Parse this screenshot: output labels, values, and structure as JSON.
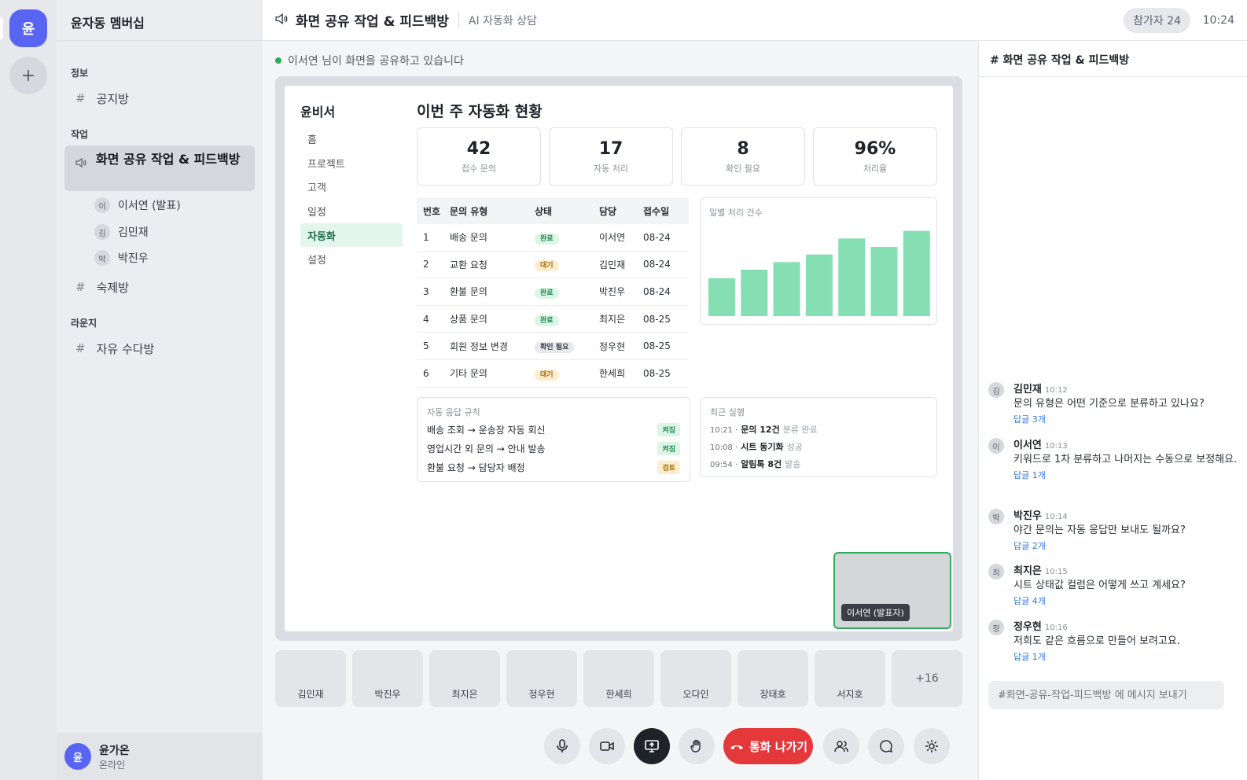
{
  "rail": {
    "server_initial": "윤",
    "add_label": "+"
  },
  "sidebar": {
    "server_name": "윤자동 멤버십",
    "categories": [
      {
        "name": "정보"
      },
      {
        "name": "작업"
      },
      {
        "name": "라운지"
      }
    ],
    "channels": {
      "notice": "공지방",
      "active": "화면 공유 작업 & 피드백방",
      "homework": "숙제방",
      "free": "자유 수다방"
    },
    "voice_users": [
      {
        "initial": "이",
        "name": "이서연 (발표)"
      },
      {
        "initial": "김",
        "name": "김민재"
      },
      {
        "initial": "박",
        "name": "박진우"
      }
    ],
    "me": {
      "initial": "윤",
      "name": "윤가온",
      "status": "온라인"
    }
  },
  "header": {
    "title": "화면 공유 작업 & 피드백방",
    "subtitle": "AI 자동화 상담",
    "participants": "참가자 24",
    "time": "10:24"
  },
  "share_notice": "이서연 님이 화면을 공유하고 있습니다",
  "shared_app": {
    "logo": "윤비서",
    "nav": [
      "홈",
      "프로젝트",
      "고객",
      "일정",
      "자동화",
      "설정"
    ],
    "active_nav": "자동화",
    "page_title": "이번 주 자동화 현황",
    "stats": [
      {
        "value": "42",
        "label": "접수 문의"
      },
      {
        "value": "17",
        "label": "자동 처리"
      },
      {
        "value": "8",
        "label": "확인 필요"
      },
      {
        "value": "96%",
        "label": "처리율"
      }
    ],
    "table": {
      "headers": [
        "번호",
        "문의 유형",
        "상태",
        "담당",
        "접수일"
      ],
      "rows": [
        {
          "no": "1",
          "type": "배송 문의",
          "status": "완료",
          "status_kind": "done",
          "owner": "이서연",
          "date": "08-24"
        },
        {
          "no": "2",
          "type": "교환 요청",
          "status": "대기",
          "status_kind": "wait",
          "owner": "김민재",
          "date": "08-24"
        },
        {
          "no": "3",
          "type": "환불 문의",
          "status": "완료",
          "status_kind": "done",
          "owner": "박진우",
          "date": "08-24"
        },
        {
          "no": "4",
          "type": "상품 문의",
          "status": "완료",
          "status_kind": "done",
          "owner": "최지은",
          "date": "08-25"
        },
        {
          "no": "5",
          "type": "회원 정보 변경",
          "status": "확인 필요",
          "status_kind": "check",
          "owner": "정우현",
          "date": "08-25"
        },
        {
          "no": "6",
          "type": "기타 문의",
          "status": "대기",
          "status_kind": "wait",
          "owner": "한세희",
          "date": "08-25"
        }
      ]
    },
    "chart_data": {
      "type": "bar",
      "title": "일별 처리 건수",
      "categories": [],
      "values": [
        45,
        55,
        64,
        73,
        92,
        82,
        101
      ],
      "ylim": [
        0,
        110
      ],
      "color": "#86dfb3"
    },
    "rules": {
      "title": "자동 응답 규칙",
      "items": [
        {
          "text": "배송 조회 → 운송장 자동 회신",
          "state": "켜짐",
          "kind": "on"
        },
        {
          "text": "영업시간 외 문의 → 안내 발송",
          "state": "켜짐",
          "kind": "on"
        },
        {
          "text": "환불 요청 → 담당자 배정",
          "state": "검토",
          "kind": "review"
        }
      ]
    },
    "recent": {
      "title": "최근 실행",
      "items": [
        {
          "time": "10:21 ·",
          "bold": "문의 12건",
          "rest": "분류 완료"
        },
        {
          "time": "10:08 ·",
          "bold": "시트 동기화",
          "rest": "성공"
        },
        {
          "time": "09:54 ·",
          "bold": "알림톡 8건",
          "rest": "발송"
        }
      ]
    }
  },
  "presenter_tag": "이서연 (발표자)",
  "tiles": [
    "김민재",
    "박진우",
    "최지은",
    "정우현",
    "한세희",
    "오다인",
    "장태호",
    "서지호"
  ],
  "tiles_more": "+16",
  "controls": {
    "leave_label": "통화 나가기",
    "danger_color": "#e5383b"
  },
  "chat": {
    "title": "# 화면 공유 작업 & 피드백방",
    "messages": [
      {
        "initial": "김",
        "name": "김민재",
        "time": "10:12",
        "text": "문의 유형은 어떤 기준으로 분류하고 있나요?",
        "replies": "답글 3개"
      },
      {
        "initial": "이",
        "name": "이서연",
        "time": "10:13",
        "text": "키워드로 1차 분류하고 나머지는 수동으로 보정해요.",
        "replies": "답글 1개"
      },
      {
        "initial": "박",
        "name": "박진우",
        "time": "10:14",
        "text": "야간 문의는 자동 응답만 보내도 될까요?",
        "replies": "답글 2개"
      },
      {
        "initial": "최",
        "name": "최지은",
        "time": "10:15",
        "text": "시트 상태값 컬럼은 어떻게 쓰고 계세요?",
        "replies": "답글 4개"
      },
      {
        "initial": "정",
        "name": "정우현",
        "time": "10:16",
        "text": "저희도 같은 흐름으로 만들어 보려고요.",
        "replies": "답글 1개"
      }
    ],
    "placeholder": "#화면-공유-작업-피드백방 에 메시지 보내기"
  }
}
